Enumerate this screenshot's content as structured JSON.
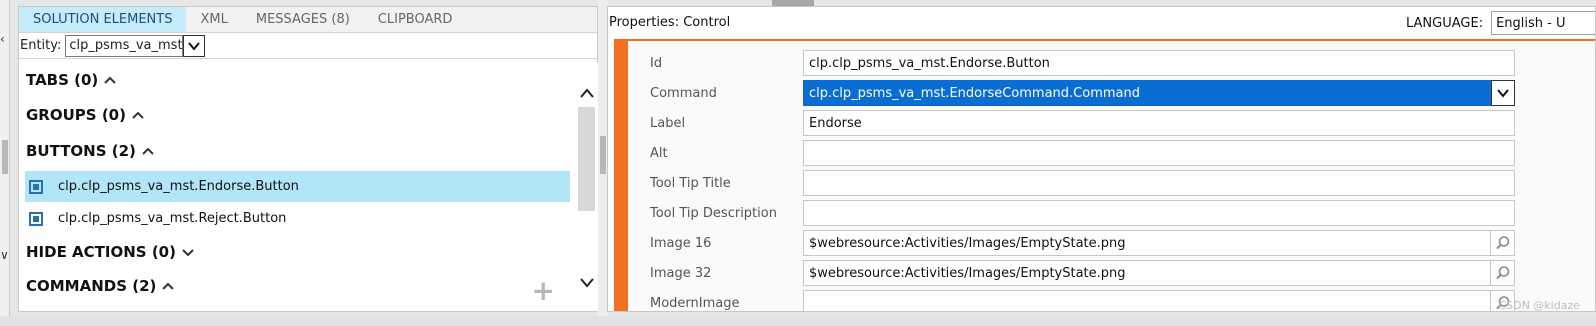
{
  "left_panel": {
    "tabs": [
      {
        "label": "SOLUTION ELEMENTS",
        "active": true
      },
      {
        "label": "XML"
      },
      {
        "label": "MESSAGES (8)"
      },
      {
        "label": "CLIPBOARD"
      }
    ],
    "entity_label": "Entity:",
    "entity_value": "clp_psms_va_mst",
    "sections": {
      "tabs": "TABS (0)",
      "groups": "GROUPS (0)",
      "buttons": "BUTTONS (2)",
      "hide_actions": "HIDE ACTIONS (0)",
      "commands": "COMMANDS (2)"
    },
    "button_items": [
      "clp.clp_psms_va_mst.Endorse.Button",
      "clp.clp_psms_va_mst.Reject.Button"
    ]
  },
  "properties": {
    "header": "Properties: Control",
    "language_label": "LANGUAGE:",
    "language_value": "English - U",
    "fields": [
      {
        "label": "Id",
        "value": "clp.clp_psms_va_mst.Endorse.Button"
      },
      {
        "label": "Command",
        "value": "clp.clp_psms_va_mst.EndorseCommand.Command"
      },
      {
        "label": "Label",
        "value": "Endorse"
      },
      {
        "label": "Alt",
        "value": ""
      },
      {
        "label": "Tool Tip Title",
        "value": ""
      },
      {
        "label": "Tool Tip Description",
        "value": ""
      },
      {
        "label": "Image 16",
        "value": "$webresource:Activities/Images/EmptyState.png"
      },
      {
        "label": "Image 32",
        "value": "$webresource:Activities/Images/EmptyState.png"
      },
      {
        "label": "ModernImage",
        "value": ""
      }
    ]
  },
  "watermark": "CSDN @kidaze",
  "colors": {
    "accent": "#f37021",
    "selected_row": "#b1e5f7",
    "active_tab": "#c5ecfa",
    "highlight": "#0a6dd3"
  }
}
